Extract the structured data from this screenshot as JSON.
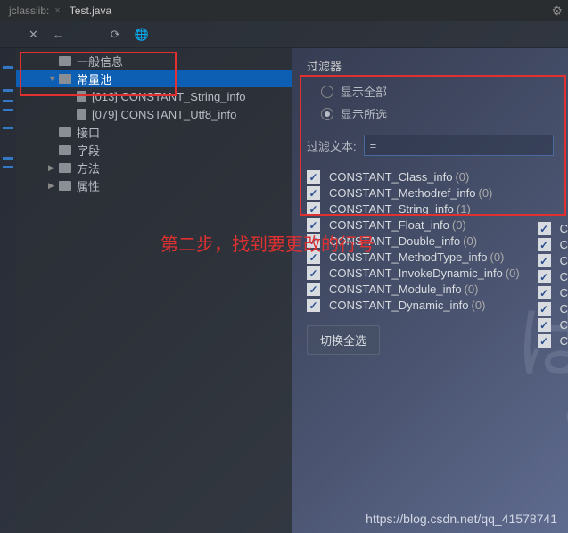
{
  "tabs": {
    "inactive": "jclasslib:",
    "active": "Test.java"
  },
  "tree": {
    "items": [
      {
        "label": "一般信息",
        "lvl": 1,
        "type": "folder"
      },
      {
        "label": "常量池",
        "lvl": 1,
        "type": "folder",
        "selected": true,
        "expanded": true
      },
      {
        "label": "[013] CONSTANT_String_info",
        "lvl": 2,
        "type": "file"
      },
      {
        "label": "[079] CONSTANT_Utf8_info",
        "lvl": 2,
        "type": "file"
      },
      {
        "label": "接口",
        "lvl": 1,
        "type": "folder"
      },
      {
        "label": "字段",
        "lvl": 1,
        "type": "folder"
      },
      {
        "label": "方法",
        "lvl": 1,
        "type": "folder",
        "arrow": true
      },
      {
        "label": "属性",
        "lvl": 1,
        "type": "folder",
        "arrow": true
      }
    ]
  },
  "filter": {
    "title": "过滤器",
    "radio_all": "显示全部",
    "radio_sel": "显示所选",
    "label": "过滤文本:",
    "value": "="
  },
  "checks": [
    {
      "label": "CONSTANT_Class_info",
      "count": "(0)"
    },
    {
      "label": "CONSTANT_Methodref_info",
      "count": "(0)"
    },
    {
      "label": "CONSTANT_String_info",
      "count": "(1)"
    },
    {
      "label": "CONSTANT_Float_info",
      "count": "(0)"
    },
    {
      "label": "CONSTANT_Double_info",
      "count": "(0)"
    },
    {
      "label": "CONSTANT_MethodType_info",
      "count": "(0)"
    },
    {
      "label": "CONSTANT_InvokeDynamic_info",
      "count": "(0)"
    },
    {
      "label": "CONSTANT_Module_info",
      "count": "(0)"
    },
    {
      "label": "CONSTANT_Dynamic_info",
      "count": "(0)"
    }
  ],
  "right_checks": [
    "C",
    "C",
    "C",
    "C",
    "C",
    "C",
    "C",
    "C"
  ],
  "toggle_label": "切换全选",
  "annotation": "第二步，找到要更改的行号",
  "watermark": "https://blog.csdn.net/qq_41578741"
}
